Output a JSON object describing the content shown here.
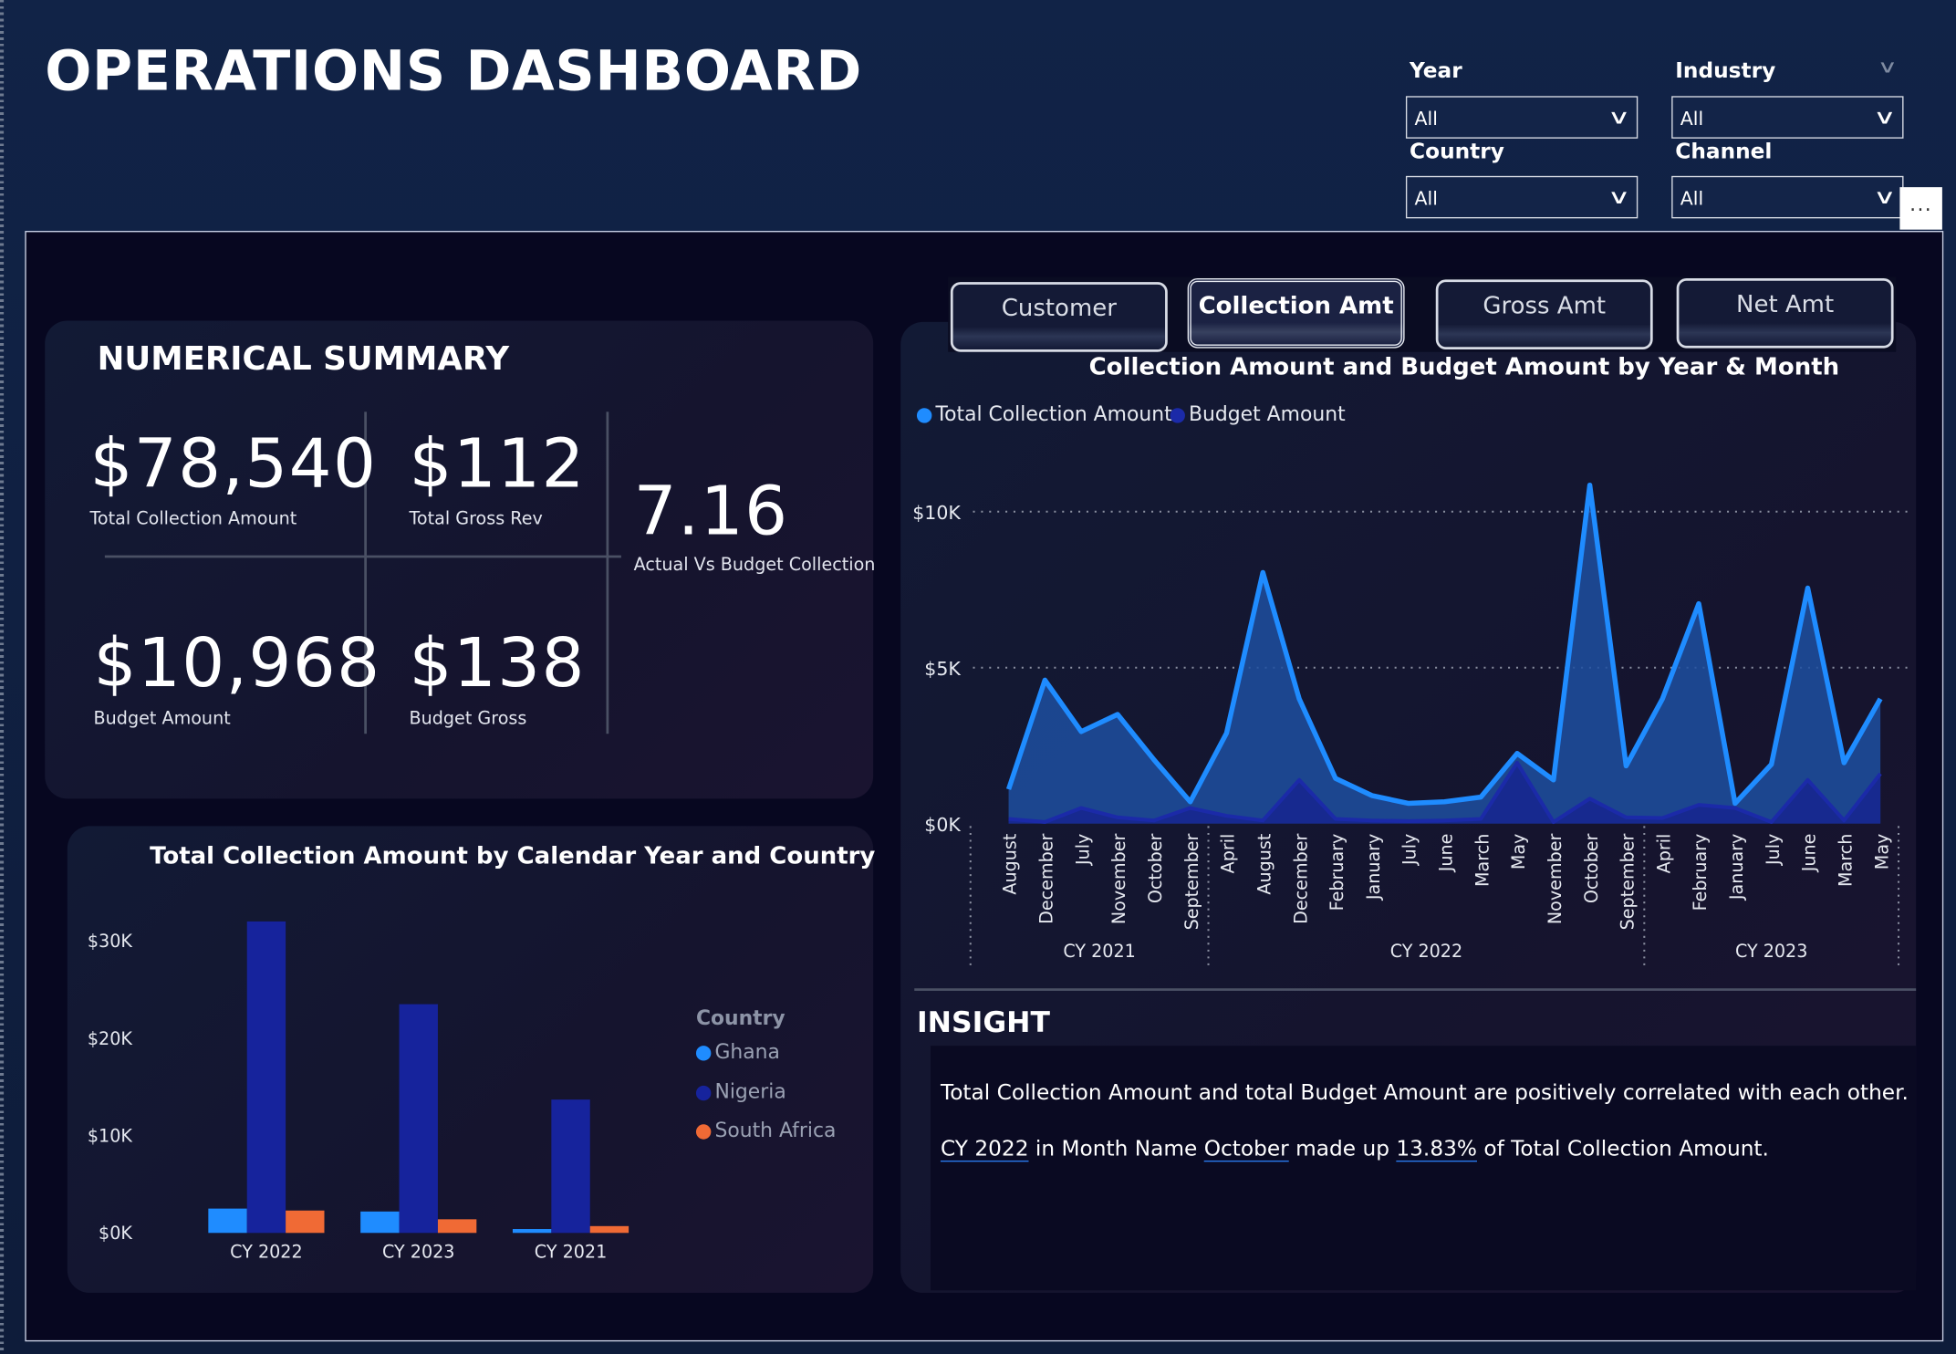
{
  "header": {
    "title": "OPERATIONS DASHBOARD"
  },
  "slicers": [
    {
      "label": "Year",
      "value": "All"
    },
    {
      "label": "Industry",
      "value": "All"
    },
    {
      "label": "Country",
      "value": "All"
    },
    {
      "label": "Channel",
      "value": "All"
    }
  ],
  "more_button": "...",
  "summary": {
    "title": "NUMERICAL SUMMARY",
    "kpis": [
      {
        "value": "$78,540",
        "label": "Total Collection Amount"
      },
      {
        "value": "$112",
        "label": "Total Gross Rev"
      },
      {
        "value": "7.16",
        "label": "Actual Vs Budget Collection"
      },
      {
        "value": "$10,968",
        "label": "Budget Amount"
      },
      {
        "value": "$138",
        "label": "Budget Gross"
      }
    ]
  },
  "tabs": [
    {
      "label": "Customer",
      "active": false
    },
    {
      "label": "Collection Amt",
      "active": true
    },
    {
      "label": "Gross Amt",
      "active": false
    },
    {
      "label": "Net Amt",
      "active": false
    }
  ],
  "colors": {
    "collection": "#1f8cff",
    "budget": "#1b2aa8",
    "ghana": "#1f8cff",
    "nigeria": "#16239c",
    "south_africa": "#f06a35"
  },
  "chart_data": [
    {
      "type": "area",
      "title": "Collection Amount and Budget Amount by Year & Month",
      "xlabel": "",
      "ylabel": "",
      "ylim": [
        0,
        11000
      ],
      "yticks": [
        "$0K",
        "$5K",
        "$10K"
      ],
      "legend": "top-left",
      "categories": [
        "August",
        "December",
        "July",
        "November",
        "October",
        "September",
        "April",
        "August",
        "December",
        "February",
        "January",
        "July",
        "June",
        "March",
        "May",
        "November",
        "October",
        "September",
        "April",
        "February",
        "January",
        "July",
        "June",
        "March",
        "May"
      ],
      "groups": [
        {
          "label": "CY 2021",
          "count": 6
        },
        {
          "label": "CY 2022",
          "count": 12
        },
        {
          "label": "CY 2023",
          "count": 7
        }
      ],
      "series": [
        {
          "name": "Total Collection Amount",
          "values": [
            1100,
            4600,
            2950,
            3500,
            2050,
            700,
            2900,
            8050,
            4000,
            1450,
            900,
            650,
            700,
            850,
            2250,
            1400,
            10850,
            1850,
            4000,
            7050,
            650,
            1900,
            7550,
            1950,
            4000
          ]
        },
        {
          "name": "Budget Amount",
          "values": [
            150,
            50,
            500,
            200,
            100,
            500,
            250,
            100,
            1400,
            150,
            100,
            80,
            100,
            150,
            1950,
            50,
            800,
            200,
            180,
            600,
            500,
            50,
            1400,
            100,
            1600
          ]
        }
      ]
    },
    {
      "type": "bar",
      "title": "Total Collection Amount by Calendar Year and Country",
      "xlabel": "",
      "ylabel": "",
      "ylim": [
        0,
        30000
      ],
      "yticks": [
        "$0K",
        "$10K",
        "$20K",
        "$30K"
      ],
      "legend_title": "Country",
      "legend": "right",
      "categories": [
        "CY 2022",
        "CY 2023",
        "CY 2021"
      ],
      "series": [
        {
          "name": "Ghana",
          "values": [
            2500,
            2200,
            400
          ]
        },
        {
          "name": "Nigeria",
          "values": [
            32000,
            23500,
            13700
          ]
        },
        {
          "name": "South Africa",
          "values": [
            2300,
            1400,
            700
          ]
        }
      ]
    }
  ],
  "insight": {
    "title": "INSIGHT",
    "line1": "Total Collection Amount and total Budget Amount are positively correlated with each other.",
    "line2": {
      "year": "CY 2022",
      "t1": " in Month Name ",
      "month": "October",
      "t2": " made up ",
      "pct": "13.83%",
      "t3": " of Total Collection Amount."
    }
  }
}
